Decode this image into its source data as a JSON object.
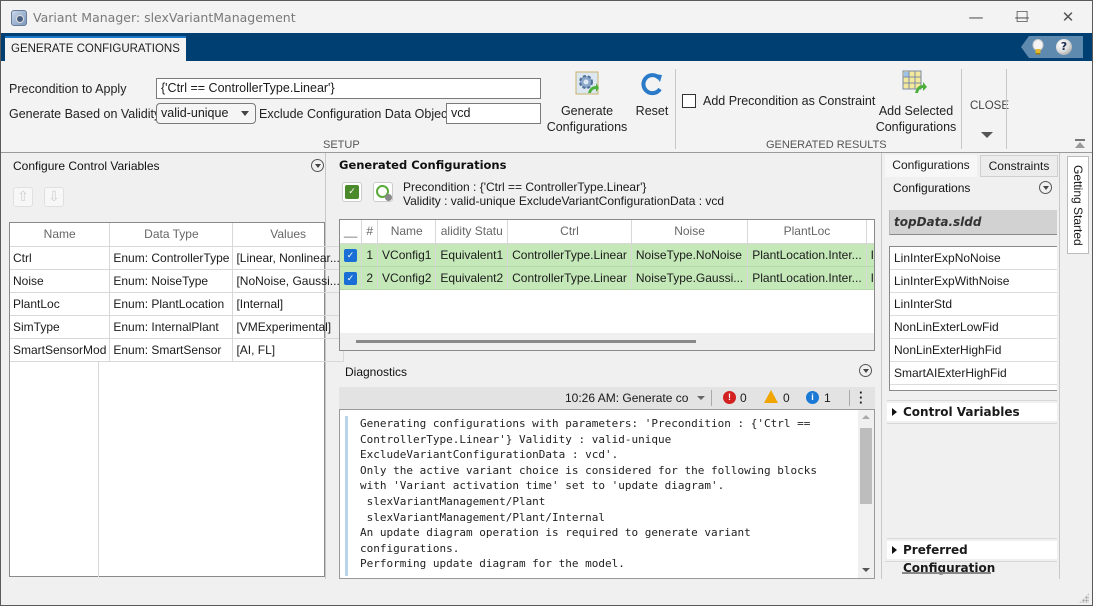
{
  "window": {
    "title": "Variant Manager: slexVariantManagement",
    "controls": {
      "minimize": "—",
      "maximize": "☐",
      "close": "✕"
    }
  },
  "ribbon": {
    "active_tab": "GENERATE CONFIGURATIONS",
    "help_icons": {
      "tip": "lightbulb-icon",
      "help": "?"
    },
    "setup": {
      "section_label": "SETUP",
      "precondition_label": "Precondition to Apply",
      "precondition_value": "{'Ctrl == ControllerType.Linear'}",
      "validity_label": "Generate Based on Validity",
      "validity_value": "valid-unique",
      "exclude_label": "Exclude Configuration Data Object",
      "exclude_value": "vcd",
      "generate_label_1": "Generate",
      "generate_label_2": "Configurations",
      "reset_label": "Reset"
    },
    "generated_results": {
      "section_label": "GENERATED RESULTS",
      "add_precondition_label": "Add Precondition as Constraint",
      "add_precondition_checked": false,
      "add_selected_label_1": "Add Selected",
      "add_selected_label_2": "Configurations"
    },
    "close": {
      "label": "CLOSE"
    }
  },
  "control_variables": {
    "title": "Configure Control Variables",
    "columns": [
      "Name",
      "Data Type",
      "Values"
    ],
    "rows": [
      {
        "name": "Ctrl",
        "type": "Enum: ControllerType",
        "values": "[Linear, Nonlinear..."
      },
      {
        "name": "Noise",
        "type": "Enum: NoiseType",
        "values": "[NoNoise, Gaussi..."
      },
      {
        "name": "PlantLoc",
        "type": "Enum: PlantLocation",
        "values": "[Internal]"
      },
      {
        "name": "SimType",
        "type": "Enum: InternalPlant",
        "values": "[VMExperimental]"
      },
      {
        "name": "SmartSensorMod",
        "type": "Enum: SmartSensor",
        "values": "[AI, FL]"
      }
    ]
  },
  "generated_configurations": {
    "title": "Generated Configurations",
    "summary_line_1": "Precondition : {'Ctrl == ControllerType.Linear'}",
    "summary_line_2": "Validity : valid-unique ExcludeVariantConfigurationData : vcd",
    "columns": [
      "__",
      "#",
      "Name",
      "alidity Statu",
      "Ctrl",
      "Noise",
      "PlantLoc",
      ""
    ],
    "rows": [
      {
        "checked": true,
        "num": "1",
        "name": "VConfig1",
        "validity": "Equivalent1",
        "ctrl": "ControllerType.Linear",
        "noise": "NoiseType.NoNoise",
        "plantloc": "PlantLocation.Inter...",
        "extra": "Intern"
      },
      {
        "checked": true,
        "num": "2",
        "name": "VConfig2",
        "validity": "Equivalent2",
        "ctrl": "ControllerType.Linear",
        "noise": "NoiseType.Gaussi...",
        "plantloc": "PlantLocation.Inter...",
        "extra": "Intern"
      }
    ]
  },
  "diagnostics": {
    "title": "Diagnostics",
    "message_selector": "10:26 AM: Generate co",
    "errors": "0",
    "warnings": "0",
    "info": "1",
    "log": "Generating configurations with parameters: 'Precondition : {'Ctrl ==\nControllerType.Linear'} Validity : valid-unique\nExcludeVariantConfigurationData : vcd'.\nOnly the active variant choice is considered for the following blocks\nwith 'Variant activation time' set to 'update diagram'.\n slexVariantManagement/Plant\n slexVariantManagement/Plant/Internal\nAn update diagram operation is required to generate variant\nconfigurations.\nPerforming update diagram for the model."
  },
  "right_panel": {
    "tabs": [
      "Configurations",
      "Constraints"
    ],
    "active_tab": "Configurations",
    "section_title": "Configurations",
    "data_source": "topData.sldd",
    "configurations": [
      "LinInterExpNoNoise",
      "LinInterExpWithNoise",
      "LinInterStd",
      "NonLinExterLowFid",
      "NonLinExterHighFid",
      "SmartAIExterHighFid"
    ],
    "control_variables_label": "Control Variables",
    "preferred_configuration_label": "Preferred Configuration",
    "getting_started_label": "Getting Started"
  }
}
